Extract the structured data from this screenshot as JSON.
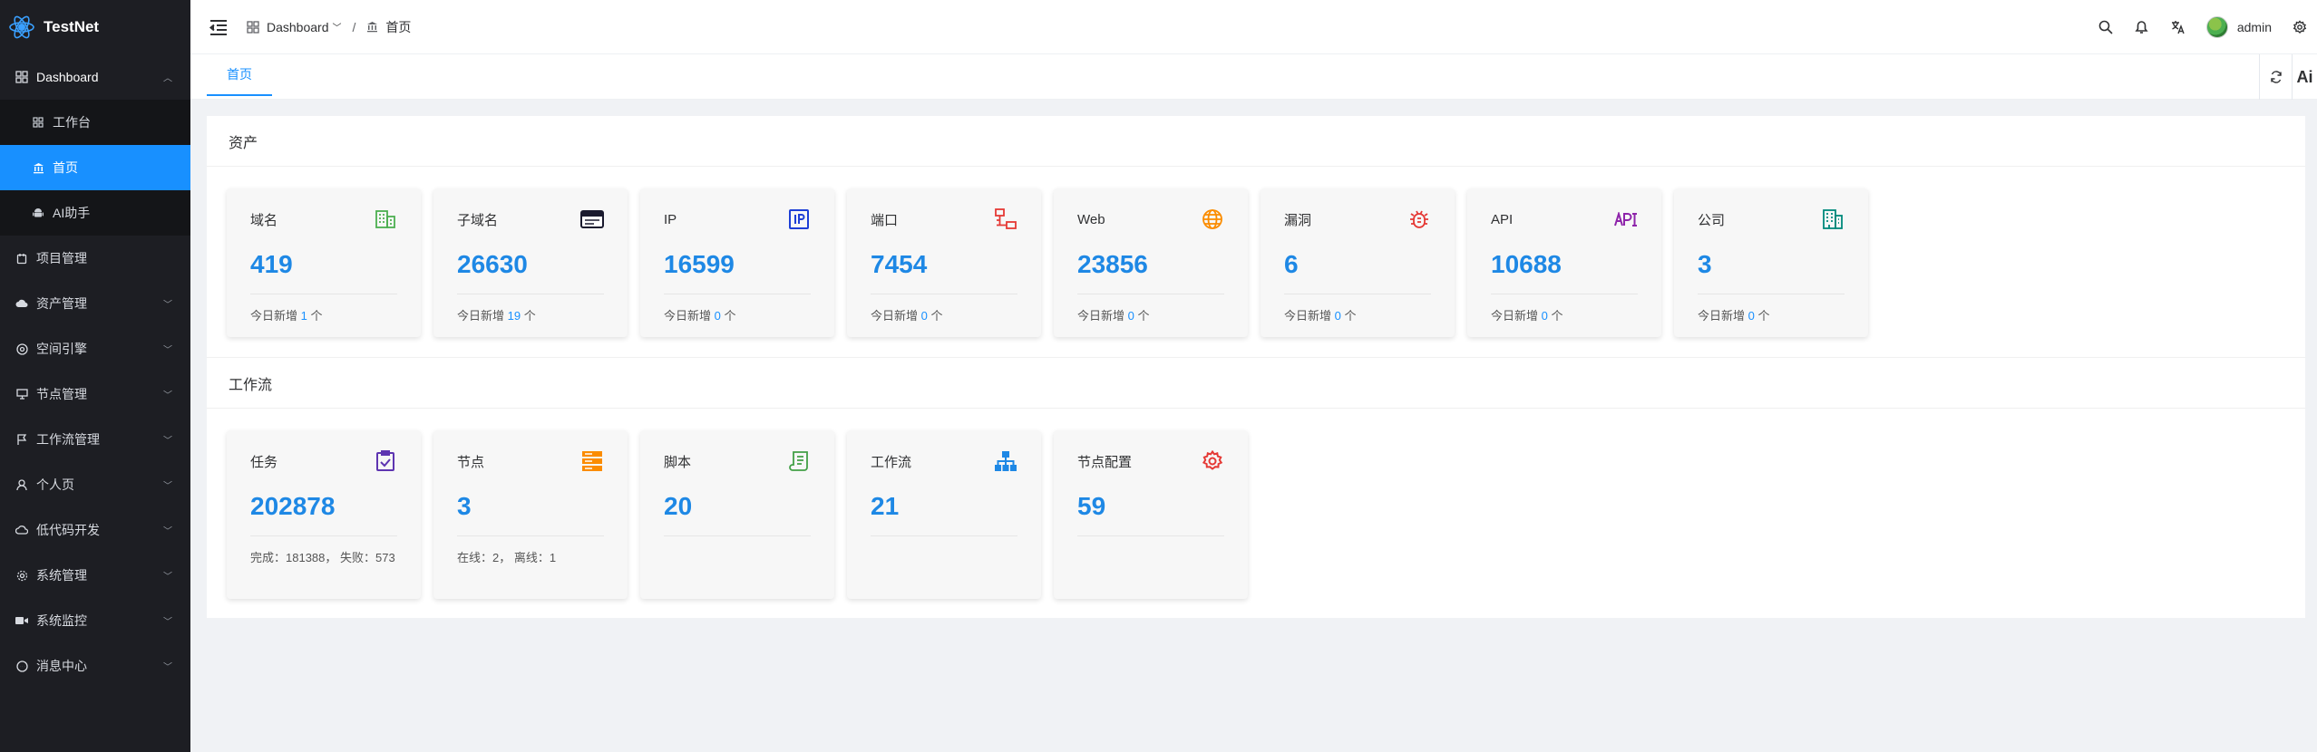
{
  "app": {
    "name": "TestNet"
  },
  "sidebar": {
    "items": [
      {
        "label": "Dashboard",
        "icon": "dashboard-icon",
        "expanded": true,
        "children": [
          {
            "label": "工作台",
            "icon": "grid-icon"
          },
          {
            "label": "首页",
            "icon": "bank-icon",
            "active": true
          },
          {
            "label": "AI助手",
            "icon": "android-icon"
          }
        ]
      },
      {
        "label": "项目管理",
        "icon": "project-icon"
      },
      {
        "label": "资产管理",
        "icon": "cloud-icon"
      },
      {
        "label": "空间引擎",
        "icon": "globe-icon"
      },
      {
        "label": "节点管理",
        "icon": "monitor-icon"
      },
      {
        "label": "工作流管理",
        "icon": "flag-icon"
      },
      {
        "label": "个人页",
        "icon": "user-icon"
      },
      {
        "label": "低代码开发",
        "icon": "cloud-outline-icon"
      },
      {
        "label": "系统管理",
        "icon": "gear-icon"
      },
      {
        "label": "系统监控",
        "icon": "video-icon"
      },
      {
        "label": "消息中心",
        "icon": "chat-icon"
      }
    ]
  },
  "header": {
    "breadcrumb": {
      "root": "Dashboard",
      "separator": "/",
      "current": "首页"
    },
    "user": "admin"
  },
  "tabs": {
    "active": "首页",
    "ai_label": "Ai"
  },
  "assets": {
    "title": "资产",
    "footer_prefix": "今日新增",
    "footer_suffix": "个",
    "cards": [
      {
        "label": "域名",
        "value": "419",
        "today": "1",
        "icon": "building-icon",
        "color": "#4caf50"
      },
      {
        "label": "子域名",
        "value": "26630",
        "today": "19",
        "icon": "browser-window-icon",
        "color": "#1a1a2e"
      },
      {
        "label": "IP",
        "value": "16599",
        "today": "0",
        "icon": "ip-icon",
        "color": "#1e3fd6"
      },
      {
        "label": "端口",
        "value": "7454",
        "today": "0",
        "icon": "network-icon",
        "color": "#e53935"
      },
      {
        "label": "Web",
        "value": "23856",
        "today": "0",
        "icon": "globe-icon",
        "color": "#fb8c00"
      },
      {
        "label": "漏洞",
        "value": "6",
        "today": "0",
        "icon": "bug-icon",
        "color": "#e53935"
      },
      {
        "label": "API",
        "value": "10688",
        "today": "0",
        "icon": "api-icon",
        "color": "#8e24aa"
      },
      {
        "label": "公司",
        "value": "3",
        "today": "0",
        "icon": "company-icon",
        "color": "#00897b"
      }
    ]
  },
  "workflow": {
    "title": "工作流",
    "cards": [
      {
        "label": "任务",
        "value": "202878",
        "footer": "完成：181388， 失败：573",
        "icon": "task-check-icon",
        "color": "#5e35b1"
      },
      {
        "label": "节点",
        "value": "3",
        "footer": "在线：2， 离线：1",
        "icon": "server-icon",
        "color": "#fb8c00"
      },
      {
        "label": "脚本",
        "value": "20",
        "footer": "",
        "icon": "script-icon",
        "color": "#43a047"
      },
      {
        "label": "工作流",
        "value": "21",
        "footer": "",
        "icon": "sitemap-icon",
        "color": "#1e88e5"
      },
      {
        "label": "节点配置",
        "value": "59",
        "footer": "",
        "icon": "gear-icon",
        "color": "#e53935"
      }
    ]
  }
}
